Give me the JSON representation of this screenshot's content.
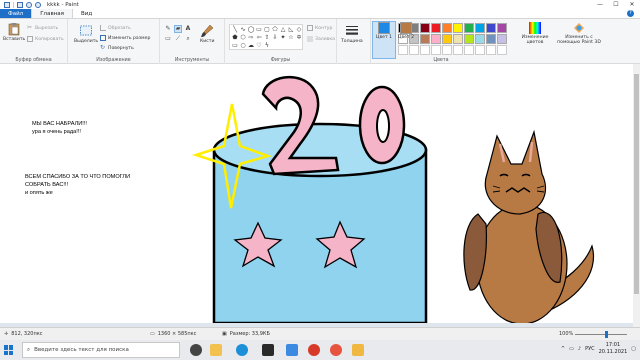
{
  "window": {
    "title": "kkkk - Paint",
    "controls": [
      "—",
      "☐",
      "✕"
    ]
  },
  "tabs": [
    "Файл",
    "Главная",
    "Вид"
  ],
  "ribbon": {
    "clipboard": {
      "paste": "Вставить",
      "cut": "Вырезать",
      "copy": "Копировать",
      "label": "Буфер обмена"
    },
    "image": {
      "select": "Выделить",
      "crop": "Обрезать",
      "resize": "Изменить размер",
      "rotate": "Повернуть",
      "label": "Изображение"
    },
    "tools": {
      "brushes": "Кисти",
      "label": "Инструменты"
    },
    "shapes": {
      "outline": "Контур",
      "fill": "Заливка",
      "label": "Фигуры"
    },
    "size": {
      "label": "Толщина"
    },
    "colors": {
      "color1": "Цвет 1",
      "color2": "Цвет 2",
      "edit": "Изменение цветов",
      "paint3d": "Изменить с помощью Paint 3D",
      "label": "Цвета",
      "color1_value": "#1e88e5",
      "color2_value": "#b87a45",
      "palette": [
        "#000000",
        "#7f7f7f",
        "#880015",
        "#ed1c24",
        "#ff7f27",
        "#fff200",
        "#22b14c",
        "#00a2e8",
        "#3f48cc",
        "#a349a4",
        "#ffffff",
        "#c3c3c3",
        "#b97a57",
        "#ffaec9",
        "#ffc90e",
        "#efe4b0",
        "#b5e61d",
        "#99d9ea",
        "#7092be",
        "#c8bfe7",
        "",
        "",
        "",
        "",
        "",
        "",
        "",
        "",
        "",
        ""
      ]
    }
  },
  "canvas": {
    "text_lines": [
      "МЫ ВАС НАБРАЛИ!!!",
      "ура я очень рада!!!",
      "ВСЕМ СПАСИБО ЗА ТО ЧТО ПОМОГЛИ",
      "СОБРАТЬ ВАС!!!",
      "и опять же"
    ],
    "number": "20",
    "colors": {
      "cake": "#8fd3ee",
      "cake_top": "#a8def3",
      "star_pink": "#f6b4c8",
      "number_pink": "#f6b4c8",
      "spark": "#ffee00",
      "cat": "#b87a45",
      "cat_dark": "#8a5a3a"
    }
  },
  "status": {
    "cursor": "812, 320пкс",
    "dimensions": "1360 × 585пкс",
    "file_size": "Размер: 33,9КБ",
    "zoom": "100%"
  },
  "taskbar": {
    "search_placeholder": "Введите здесь текст для поиска",
    "language": "РУС",
    "time": "17:01",
    "date": "20.11.2021"
  }
}
